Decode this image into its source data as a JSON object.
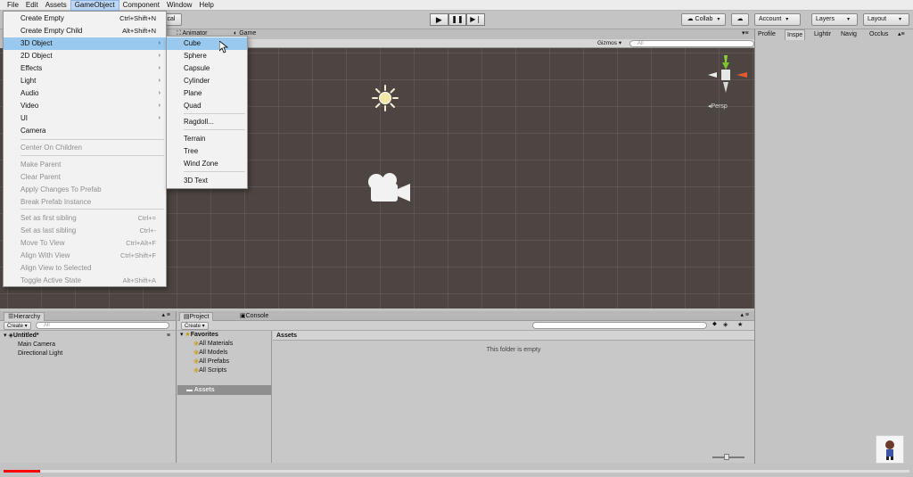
{
  "menubar": [
    "File",
    "Edit",
    "Assets",
    "GameObject",
    "Component",
    "Window",
    "Help"
  ],
  "toolbar": {
    "layout_btn_partial": "cal",
    "collab": "Collab",
    "account": "Account",
    "layers": "Layers",
    "layout": "Layout"
  },
  "scene": {
    "tab_animator": "Animator",
    "tab_game": "Game",
    "gizmos": "Gizmos",
    "search_placeholder": "All",
    "persp_label": "Persp"
  },
  "gameobject_menu": {
    "items": [
      {
        "label": "Create Empty",
        "shortcut": "Ctrl+Shift+N"
      },
      {
        "label": "Create Empty Child",
        "shortcut": "Alt+Shift+N"
      },
      {
        "label": "3D Object",
        "submenu": true,
        "highlighted": true
      },
      {
        "label": "2D Object",
        "submenu": true
      },
      {
        "label": "Effects",
        "submenu": true
      },
      {
        "label": "Light",
        "submenu": true
      },
      {
        "label": "Audio",
        "submenu": true
      },
      {
        "label": "Video",
        "submenu": true
      },
      {
        "label": "UI",
        "submenu": true
      },
      {
        "label": "Camera"
      },
      {
        "label": "Center On Children",
        "disabled": true
      },
      {
        "label": "Make Parent",
        "disabled": true
      },
      {
        "label": "Clear Parent",
        "disabled": true
      },
      {
        "label": "Apply Changes To Prefab",
        "disabled": true
      },
      {
        "label": "Break Prefab Instance",
        "disabled": true
      },
      {
        "label": "Set as first sibling",
        "shortcut": "Ctrl+=",
        "disabled": true
      },
      {
        "label": "Set as last sibling",
        "shortcut": "Ctrl+-",
        "disabled": true
      },
      {
        "label": "Move To View",
        "shortcut": "Ctrl+Alt+F",
        "disabled": true
      },
      {
        "label": "Align With View",
        "shortcut": "Ctrl+Shift+F",
        "disabled": true
      },
      {
        "label": "Align View to Selected",
        "disabled": true
      },
      {
        "label": "Toggle Active State",
        "shortcut": "Alt+Shift+A",
        "disabled": true
      }
    ]
  },
  "object3d_submenu": {
    "items": [
      "Cube",
      "Sphere",
      "Capsule",
      "Cylinder",
      "Plane",
      "Quad",
      "Ragdoll...",
      "Terrain",
      "Tree",
      "Wind Zone",
      "3D Text"
    ],
    "highlighted": "Cube"
  },
  "hierarchy": {
    "tab": "Hierarchy",
    "create": "Create",
    "search_placeholder": "All",
    "scene_name": "Untitled*",
    "items": [
      "Main Camera",
      "Directional Light"
    ]
  },
  "project": {
    "tab_project": "Project",
    "tab_console": "Console",
    "create": "Create",
    "favorites": "Favorites",
    "favorites_items": [
      "All Materials",
      "All Models",
      "All Prefabs",
      "All Scripts"
    ],
    "assets_folder": "Assets",
    "assets_header": "Assets",
    "empty_message": "This folder is empty"
  },
  "inspector": {
    "tabs": [
      "Profile",
      "Inspe",
      "Lightir",
      "Navig",
      "Occlus"
    ]
  },
  "colors": {
    "scene_bg": "#4d4541",
    "menu_highlight": "#99c9ef",
    "progress": "#ff0000"
  },
  "video_progress": 0.04
}
